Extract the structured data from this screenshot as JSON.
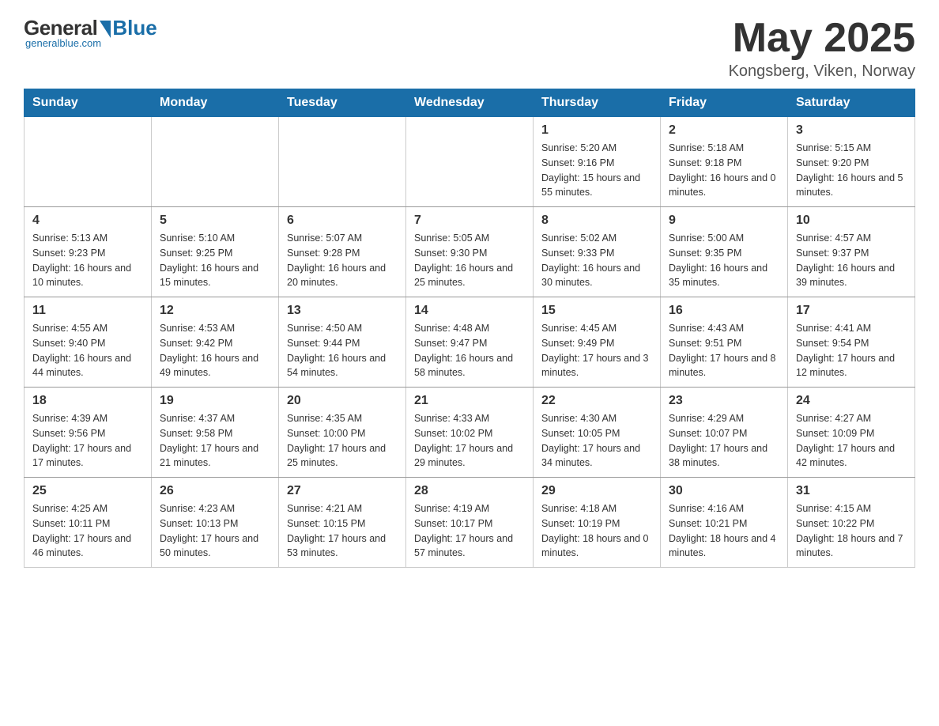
{
  "header": {
    "logo": {
      "general": "General",
      "blue": "Blue",
      "subtitle": "generalblue.com"
    },
    "title": "May 2025",
    "location": "Kongsberg, Viken, Norway"
  },
  "days_of_week": [
    "Sunday",
    "Monday",
    "Tuesday",
    "Wednesday",
    "Thursday",
    "Friday",
    "Saturday"
  ],
  "weeks": [
    [
      {
        "day": "",
        "info": ""
      },
      {
        "day": "",
        "info": ""
      },
      {
        "day": "",
        "info": ""
      },
      {
        "day": "",
        "info": ""
      },
      {
        "day": "1",
        "info": "Sunrise: 5:20 AM\nSunset: 9:16 PM\nDaylight: 15 hours\nand 55 minutes."
      },
      {
        "day": "2",
        "info": "Sunrise: 5:18 AM\nSunset: 9:18 PM\nDaylight: 16 hours\nand 0 minutes."
      },
      {
        "day": "3",
        "info": "Sunrise: 5:15 AM\nSunset: 9:20 PM\nDaylight: 16 hours\nand 5 minutes."
      }
    ],
    [
      {
        "day": "4",
        "info": "Sunrise: 5:13 AM\nSunset: 9:23 PM\nDaylight: 16 hours\nand 10 minutes."
      },
      {
        "day": "5",
        "info": "Sunrise: 5:10 AM\nSunset: 9:25 PM\nDaylight: 16 hours\nand 15 minutes."
      },
      {
        "day": "6",
        "info": "Sunrise: 5:07 AM\nSunset: 9:28 PM\nDaylight: 16 hours\nand 20 minutes."
      },
      {
        "day": "7",
        "info": "Sunrise: 5:05 AM\nSunset: 9:30 PM\nDaylight: 16 hours\nand 25 minutes."
      },
      {
        "day": "8",
        "info": "Sunrise: 5:02 AM\nSunset: 9:33 PM\nDaylight: 16 hours\nand 30 minutes."
      },
      {
        "day": "9",
        "info": "Sunrise: 5:00 AM\nSunset: 9:35 PM\nDaylight: 16 hours\nand 35 minutes."
      },
      {
        "day": "10",
        "info": "Sunrise: 4:57 AM\nSunset: 9:37 PM\nDaylight: 16 hours\nand 39 minutes."
      }
    ],
    [
      {
        "day": "11",
        "info": "Sunrise: 4:55 AM\nSunset: 9:40 PM\nDaylight: 16 hours\nand 44 minutes."
      },
      {
        "day": "12",
        "info": "Sunrise: 4:53 AM\nSunset: 9:42 PM\nDaylight: 16 hours\nand 49 minutes."
      },
      {
        "day": "13",
        "info": "Sunrise: 4:50 AM\nSunset: 9:44 PM\nDaylight: 16 hours\nand 54 minutes."
      },
      {
        "day": "14",
        "info": "Sunrise: 4:48 AM\nSunset: 9:47 PM\nDaylight: 16 hours\nand 58 minutes."
      },
      {
        "day": "15",
        "info": "Sunrise: 4:45 AM\nSunset: 9:49 PM\nDaylight: 17 hours\nand 3 minutes."
      },
      {
        "day": "16",
        "info": "Sunrise: 4:43 AM\nSunset: 9:51 PM\nDaylight: 17 hours\nand 8 minutes."
      },
      {
        "day": "17",
        "info": "Sunrise: 4:41 AM\nSunset: 9:54 PM\nDaylight: 17 hours\nand 12 minutes."
      }
    ],
    [
      {
        "day": "18",
        "info": "Sunrise: 4:39 AM\nSunset: 9:56 PM\nDaylight: 17 hours\nand 17 minutes."
      },
      {
        "day": "19",
        "info": "Sunrise: 4:37 AM\nSunset: 9:58 PM\nDaylight: 17 hours\nand 21 minutes."
      },
      {
        "day": "20",
        "info": "Sunrise: 4:35 AM\nSunset: 10:00 PM\nDaylight: 17 hours\nand 25 minutes."
      },
      {
        "day": "21",
        "info": "Sunrise: 4:33 AM\nSunset: 10:02 PM\nDaylight: 17 hours\nand 29 minutes."
      },
      {
        "day": "22",
        "info": "Sunrise: 4:30 AM\nSunset: 10:05 PM\nDaylight: 17 hours\nand 34 minutes."
      },
      {
        "day": "23",
        "info": "Sunrise: 4:29 AM\nSunset: 10:07 PM\nDaylight: 17 hours\nand 38 minutes."
      },
      {
        "day": "24",
        "info": "Sunrise: 4:27 AM\nSunset: 10:09 PM\nDaylight: 17 hours\nand 42 minutes."
      }
    ],
    [
      {
        "day": "25",
        "info": "Sunrise: 4:25 AM\nSunset: 10:11 PM\nDaylight: 17 hours\nand 46 minutes."
      },
      {
        "day": "26",
        "info": "Sunrise: 4:23 AM\nSunset: 10:13 PM\nDaylight: 17 hours\nand 50 minutes."
      },
      {
        "day": "27",
        "info": "Sunrise: 4:21 AM\nSunset: 10:15 PM\nDaylight: 17 hours\nand 53 minutes."
      },
      {
        "day": "28",
        "info": "Sunrise: 4:19 AM\nSunset: 10:17 PM\nDaylight: 17 hours\nand 57 minutes."
      },
      {
        "day": "29",
        "info": "Sunrise: 4:18 AM\nSunset: 10:19 PM\nDaylight: 18 hours\nand 0 minutes."
      },
      {
        "day": "30",
        "info": "Sunrise: 4:16 AM\nSunset: 10:21 PM\nDaylight: 18 hours\nand 4 minutes."
      },
      {
        "day": "31",
        "info": "Sunrise: 4:15 AM\nSunset: 10:22 PM\nDaylight: 18 hours\nand 7 minutes."
      }
    ]
  ]
}
